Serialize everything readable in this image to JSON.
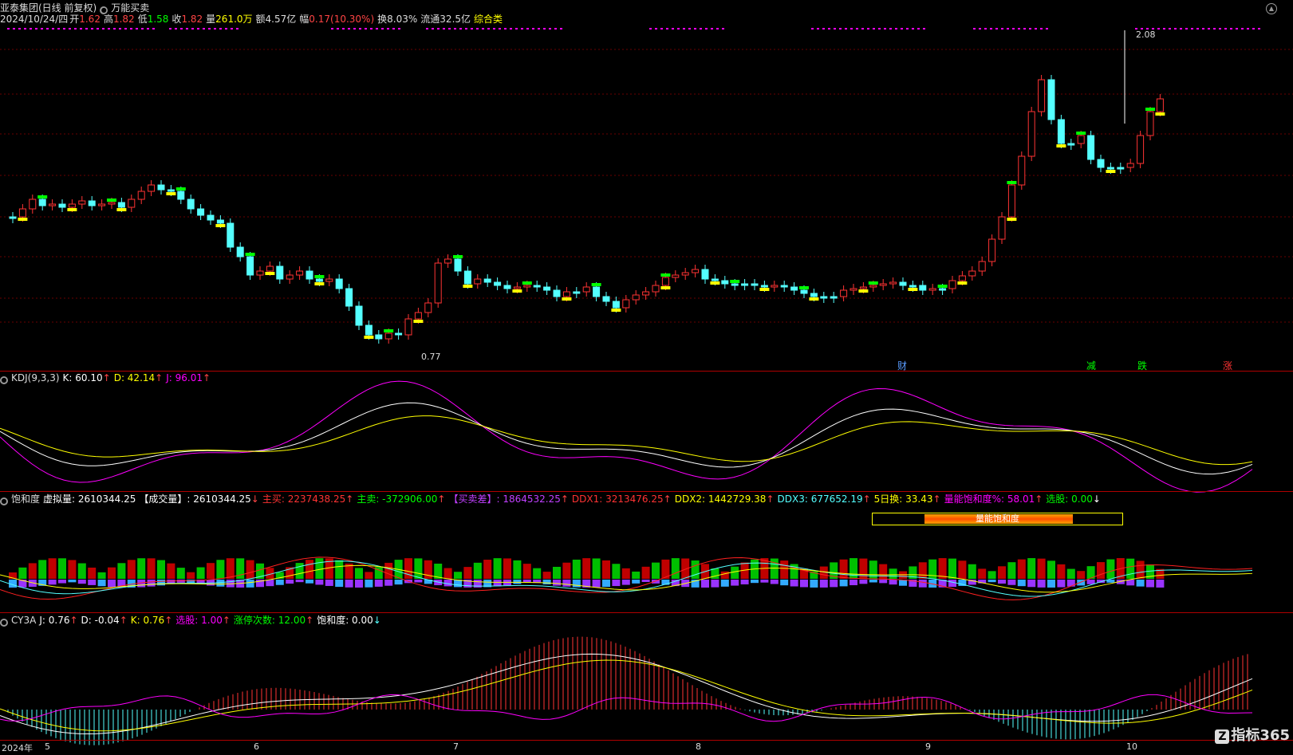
{
  "colors": {
    "up": "#ff3333",
    "down": "#54ffff",
    "yellow": "#ffff00",
    "green": "#00ff00",
    "magenta": "#ff00ff",
    "white": "#ffffff",
    "bg": "#000000",
    "grid": "#8b0000"
  },
  "header": {
    "stock_name": "亚泰集团(日线 前复权)",
    "indicator": "万能买卖",
    "date": "2024/10/24/四",
    "open_label": "开",
    "open": "1.62",
    "high_label": "高",
    "high": "1.82",
    "low_label": "低",
    "low": "1.58",
    "close_label": "收",
    "close": "1.82",
    "volume_label": "量",
    "volume": "261.0万",
    "amount_label": "额",
    "amount": "4.57亿",
    "change_label": "幅",
    "change": "0.17(10.30%)",
    "turnover_label": "换",
    "turnover": "8.03%",
    "float_label": "流通",
    "float": "32.5亿",
    "category": "综合类"
  },
  "price_labels": {
    "high": "2.08",
    "low": "0.77"
  },
  "event_tags": {
    "cai": "财",
    "jian": "减",
    "die": "跌",
    "zhang": "涨"
  },
  "kdj": {
    "name": "KDJ(9,3,3)",
    "k": "K: 60.10",
    "d": "D: 42.14",
    "j": "J: 96.01"
  },
  "sat": {
    "name": "饱和度",
    "xnl": "虚拟量: 2610344.25",
    "cjl": "【成交量】: 2610344.25",
    "zm": "主买: 2237438.25",
    "zs": "主卖: -372906.00",
    "mmc": "【买卖差】: 1864532.25",
    "ddx1": "DDX1: 3213476.25",
    "ddx2": "DDX2: 1442729.38",
    "ddx3": "DDX3: 677652.19",
    "rh": "5日换: 33.43",
    "lnbhd": "量能饱和度%: 58.01",
    "xg": "选股: 0.00",
    "bar_label": "量能饱和度",
    "bar_fill_pct": 58.01
  },
  "cy3a": {
    "name": "CY3A",
    "j": "J: 0.76",
    "d": "D: -0.04",
    "k": "K: 0.76",
    "xg": "选股: 1.00",
    "ztcs": "涨停次数: 12.00",
    "bhd": "饱和度: 0.00"
  },
  "xaxis": {
    "year": "2024年",
    "months": [
      "5",
      "6",
      "7",
      "8",
      "9",
      "10"
    ]
  },
  "watermark": {
    "logo": "Z",
    "text": "指标365"
  }
}
